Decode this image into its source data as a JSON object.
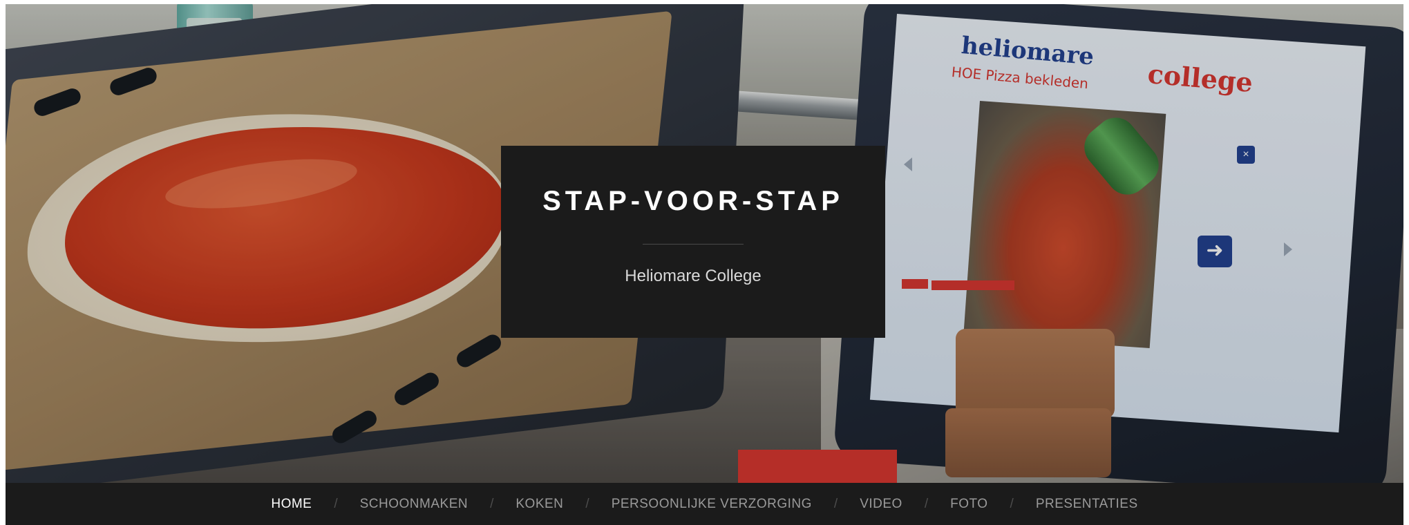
{
  "site": {
    "title": "STAP-VOOR-STAP",
    "tagline": "Heliomare College"
  },
  "hero": {
    "tablet_brand_left": "heliomare",
    "tablet_brand_right": "college",
    "tablet_subtitle": "HOE Pizza bekleden",
    "tablet_close_glyph": "×",
    "tablet_next_glyph": "➜"
  },
  "nav": {
    "separator": "/",
    "items": [
      {
        "label": "HOME",
        "active": true
      },
      {
        "label": "SCHOONMAKEN",
        "active": false
      },
      {
        "label": "KOKEN",
        "active": false
      },
      {
        "label": "PERSOONLIJKE VERZORGING",
        "active": false
      },
      {
        "label": "VIDEO",
        "active": false
      },
      {
        "label": "FOTO",
        "active": false
      },
      {
        "label": "PRESENTATIES",
        "active": false
      }
    ]
  },
  "colors": {
    "bar_background": "#1b1b1b",
    "nav_active": "#ffffff",
    "nav_inactive": "#9a9a9a",
    "brand_blue": "#1f3f8f",
    "brand_red": "#d7342e"
  }
}
